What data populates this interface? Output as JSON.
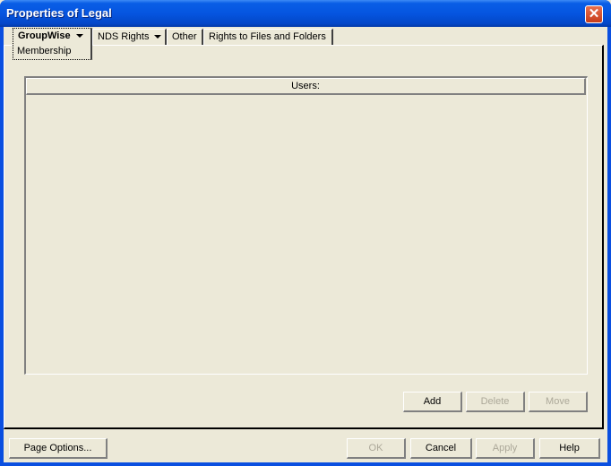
{
  "window": {
    "title": "Properties of Legal"
  },
  "tabs": [
    {
      "label": "GroupWise",
      "has_dropdown": true,
      "active": true,
      "sub_label": "Membership"
    },
    {
      "label": "NDS Rights",
      "has_dropdown": true,
      "active": false
    },
    {
      "label": "Other",
      "has_dropdown": false,
      "active": false
    },
    {
      "label": "Rights to Files and Folders",
      "has_dropdown": false,
      "active": false
    }
  ],
  "users_list": {
    "header": "Users:",
    "items": []
  },
  "list_buttons": {
    "add": "Add",
    "delete": "Delete",
    "move": "Move"
  },
  "footer_buttons": {
    "page_options": "Page Options...",
    "ok": "OK",
    "cancel": "Cancel",
    "apply": "Apply",
    "help": "Help"
  }
}
